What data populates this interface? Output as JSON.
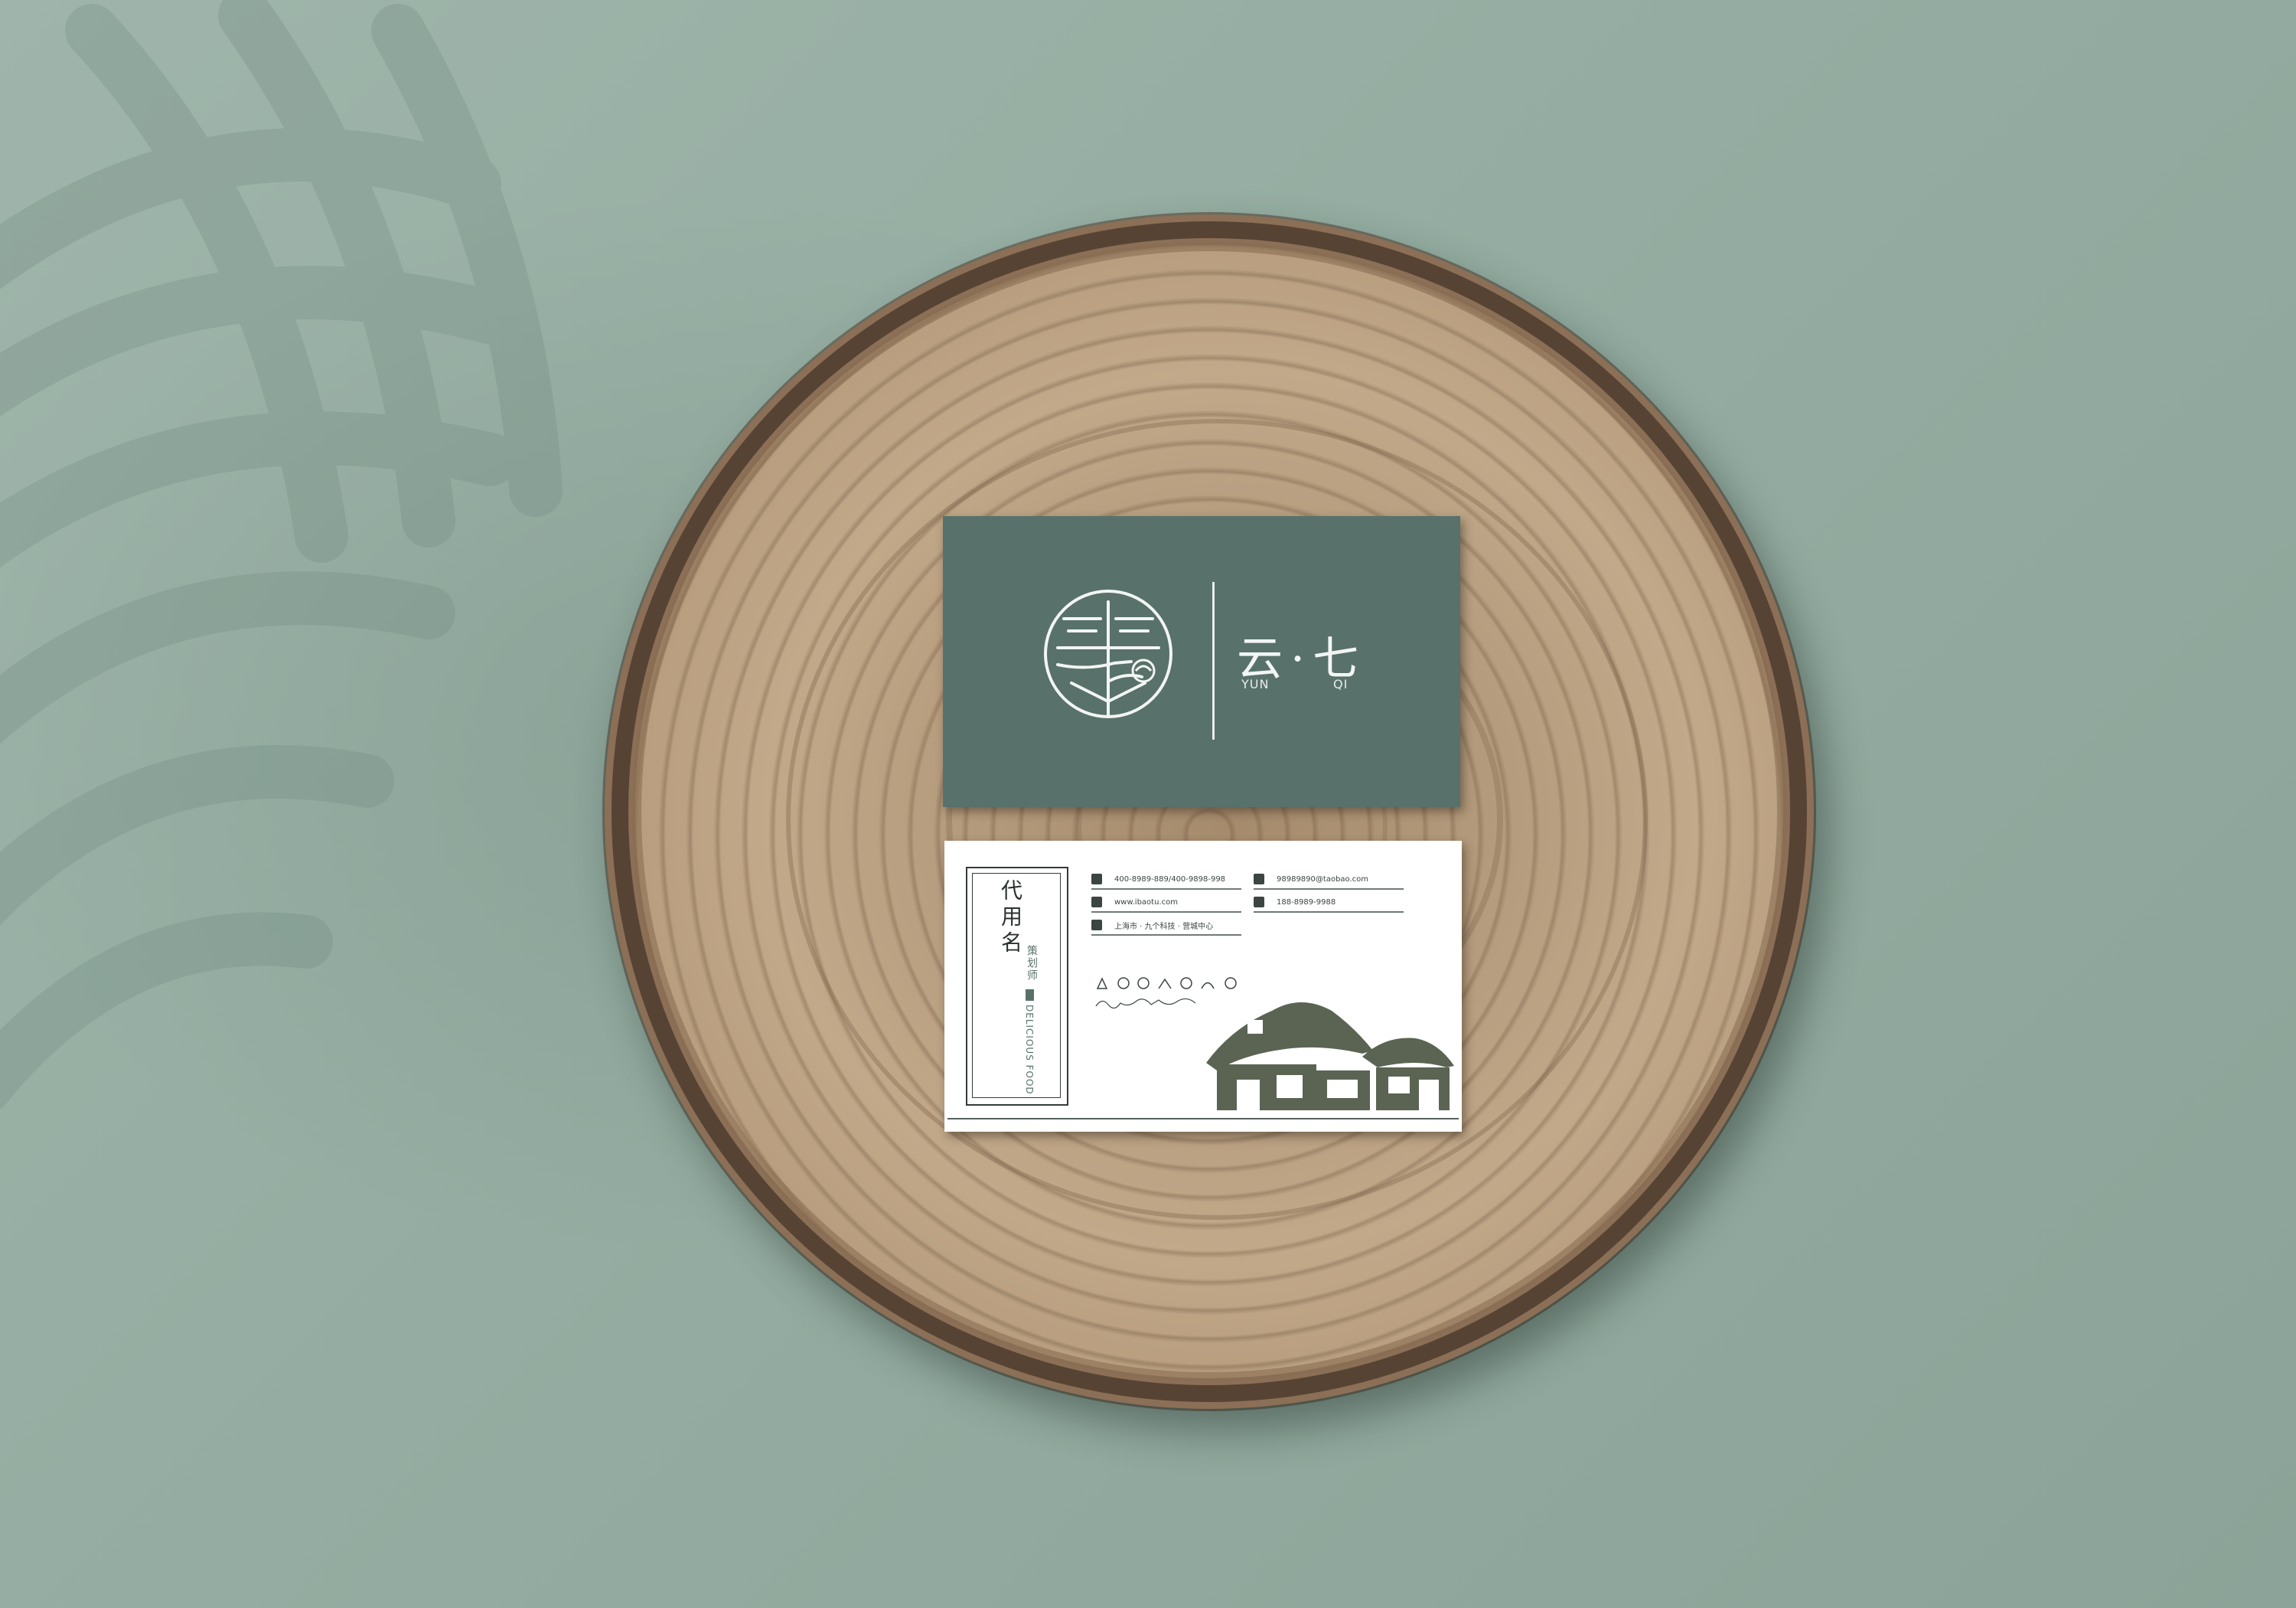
{
  "background": {
    "color": "#93aaa0",
    "shadow_color": "#7f978c"
  },
  "wood": {
    "color": "#b49a7c",
    "bark_color": "#5e4a38"
  },
  "card_front": {
    "color": "#58716b",
    "brand_cn": "云·七",
    "brand_en_1": "YUN",
    "brand_en_2": "QI"
  },
  "card_back": {
    "name_cn": "代用名",
    "title_cn": "策划师",
    "tagline": "DELICIOUS FOOD",
    "contacts": {
      "phone": "400-8989-889/400-9898-998",
      "email": "98989890@taobao.com",
      "website": "www.ibaotu.com",
      "mobile": "188-8989-9988",
      "address": "上海市 · 九个科技 · 营城中心"
    },
    "icons": [
      "phone-icon",
      "mail-icon",
      "globe-icon",
      "mobile-icon",
      "location-icon"
    ],
    "accent_color": "#58716b",
    "house_color": "#5b6453"
  }
}
